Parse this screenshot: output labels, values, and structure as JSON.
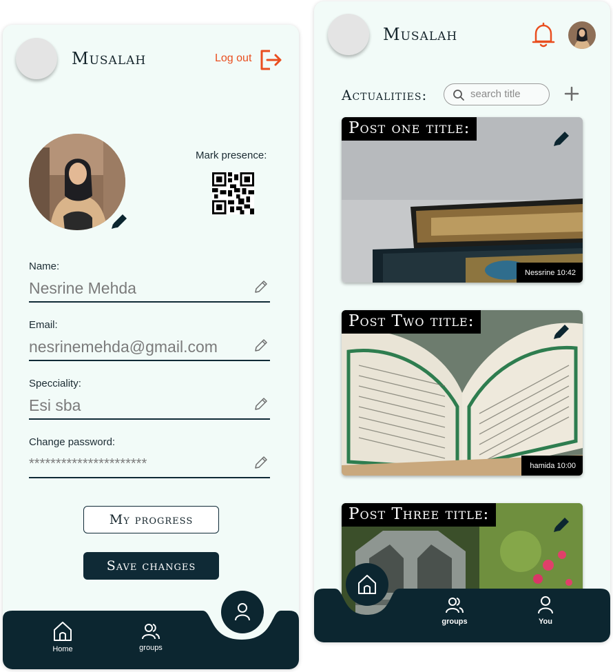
{
  "left": {
    "app_title": "Musalah",
    "logout_label": "Log out",
    "presence_label": "Mark presence:",
    "fields": [
      {
        "label": "Name:",
        "value": "Nesrine Mehda"
      },
      {
        "label": "Email:",
        "value": "nesrinemehda@gmail.com"
      },
      {
        "label": "Specciality:",
        "value": "Esi sba"
      },
      {
        "label": "Change password:",
        "value": "**********************"
      }
    ],
    "progress_button": "My progress",
    "save_button": "Save changes",
    "nav": {
      "home": "Home",
      "groups": "groups"
    }
  },
  "right": {
    "app_title": "Musalah",
    "section_title": "Actualities:",
    "search_placeholder": "search title",
    "posts": [
      {
        "title": "Post one title:",
        "meta": "Nessrine 10:42"
      },
      {
        "title": "Post Two title:",
        "meta": "hamida 10:00"
      },
      {
        "title": "Post Three title:",
        "meta": ""
      }
    ],
    "nav": {
      "groups": "groups",
      "you": "You"
    }
  },
  "colors": {
    "accent": "#e94e1f",
    "dark": "#0c2630",
    "background": "#f2fbf8"
  },
  "icons": [
    "logout-icon",
    "edit-pencil-icon",
    "qr-code-icon",
    "pencil-outline-icon",
    "home-icon",
    "groups-icon",
    "user-icon",
    "bell-icon",
    "search-icon",
    "plus-icon"
  ]
}
